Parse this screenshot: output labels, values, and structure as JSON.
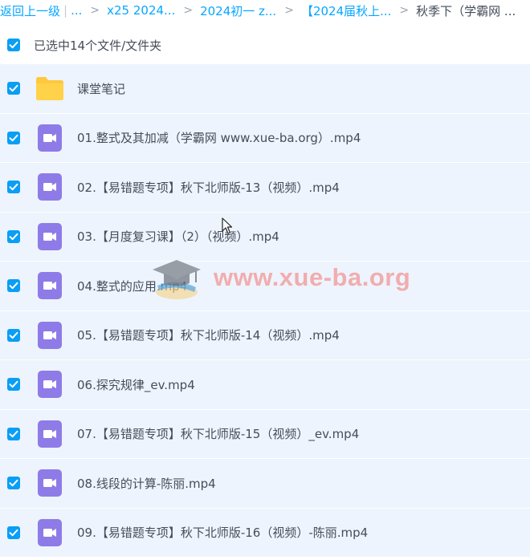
{
  "breadcrumb": {
    "back": "返回上一级",
    "pipe": "|",
    "ellipsis": "...",
    "sep": ">",
    "items": [
      "x25 2024...",
      "2024初一 z...",
      "【2024届秋上...",
      "秋季下（学霸网 ..."
    ]
  },
  "selection": {
    "text": "已选中14个文件/文件夹",
    "checked": true
  },
  "files": [
    {
      "name": "课堂笔记",
      "type": "folder",
      "checked": true
    },
    {
      "name": "01.整式及其加减（学霸网 www.xue-ba.org）.mp4",
      "type": "video",
      "checked": true
    },
    {
      "name": "02.【易错题专项】秋下北师版-13（视频）.mp4",
      "type": "video",
      "checked": true
    },
    {
      "name": "03.【月度复习课】（2）（视频）.mp4",
      "type": "video",
      "checked": true
    },
    {
      "name": "04.整式的应用.mp4",
      "type": "video",
      "checked": true
    },
    {
      "name": "05.【易错题专项】秋下北师版-14（视频）.mp4",
      "type": "video",
      "checked": true
    },
    {
      "name": "06.探究规律_ev.mp4",
      "type": "video",
      "checked": true
    },
    {
      "name": "07.【易错题专项】秋下北师版-15（视频）_ev.mp4",
      "type": "video",
      "checked": true
    },
    {
      "name": "08.线段的计算-陈丽.mp4",
      "type": "video",
      "checked": true
    },
    {
      "name": "09.【易错题专项】秋下北师版-16（视频）-陈丽.mp4",
      "type": "video",
      "checked": true
    }
  ],
  "watermark": {
    "text": "www.xue-ba.org"
  },
  "colors": {
    "accent": "#06a7ff",
    "checkbox": "#0a9ef5",
    "row_bg": "#edf4fd",
    "folder": "#ffd249",
    "video": "#8e7be8",
    "text": "#454d5a"
  },
  "icons": {
    "checkbox": "check-icon",
    "folder": "folder-icon",
    "video": "video-file-icon"
  }
}
